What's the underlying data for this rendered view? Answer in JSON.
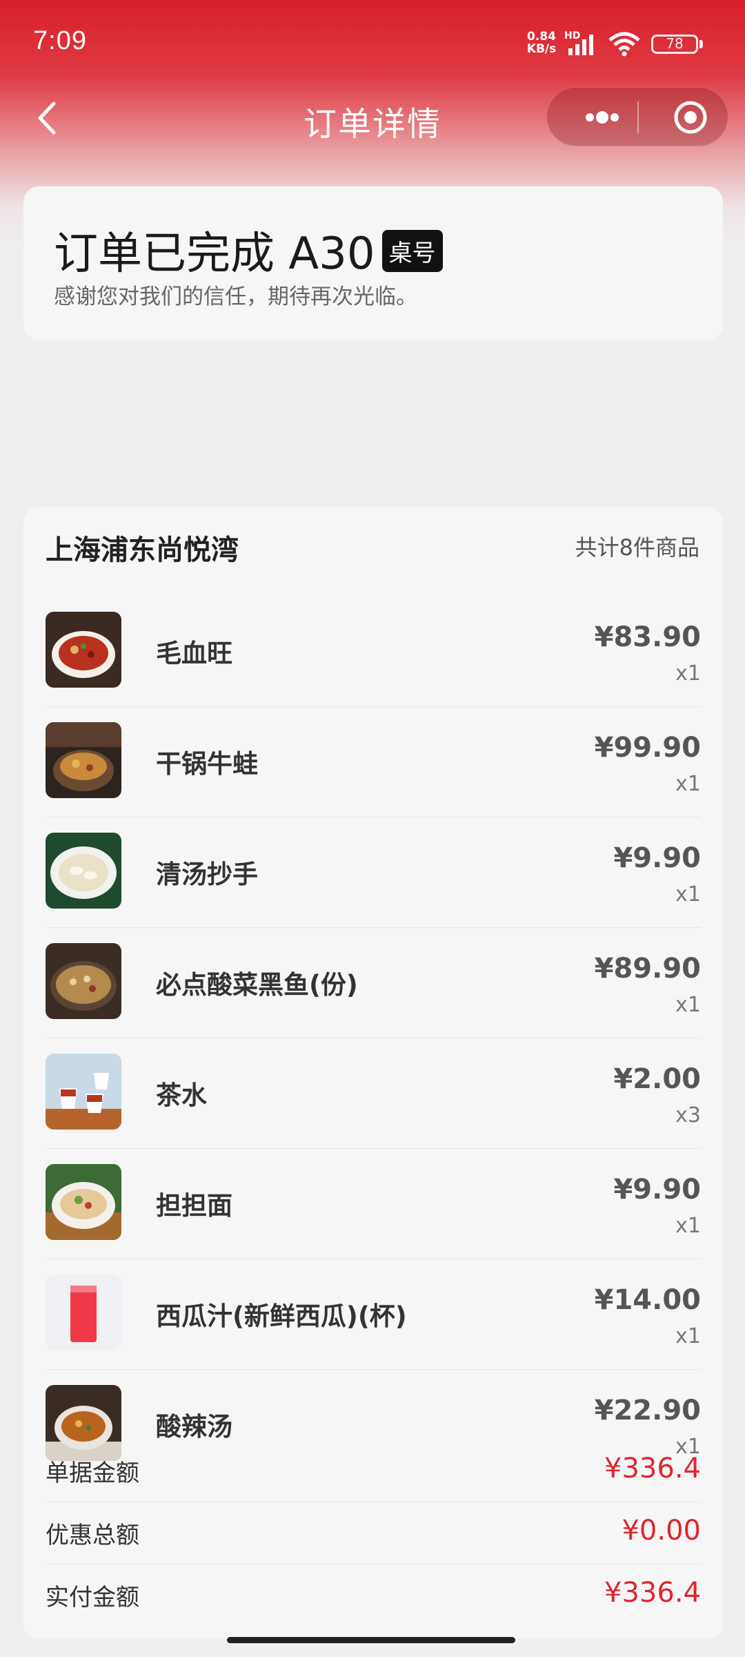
{
  "status_bar": {
    "time": "7:09",
    "net_speed_value": "0.84",
    "net_speed_unit": "KB/s",
    "hd": "HD",
    "battery": "78"
  },
  "nav": {
    "title": "订单详情",
    "icons": [
      "back-icon",
      "more-icon",
      "target-icon"
    ]
  },
  "order_status": {
    "title": "订单已完成 A30",
    "table_badge": "桌号",
    "subtitle": "感谢您对我们的信任，期待再次光临。"
  },
  "order": {
    "store_name": "上海浦东尚悦湾",
    "item_count": "共计8件商品",
    "items": [
      {
        "name": "毛血旺",
        "price": "¥83.90",
        "qty": "x1",
        "thumb": "dish-maoxuewang"
      },
      {
        "name": "干锅牛蛙",
        "price": "¥99.90",
        "qty": "x1",
        "thumb": "dish-ganguo-niuwa"
      },
      {
        "name": "清汤抄手",
        "price": "¥9.90",
        "qty": "x1",
        "thumb": "dish-chaoshou"
      },
      {
        "name": "必点酸菜黑鱼(份)",
        "price": "¥89.90",
        "qty": "x1",
        "thumb": "dish-suancai-yu"
      },
      {
        "name": "茶水",
        "price": "¥2.00",
        "qty": "x3",
        "thumb": "dish-tea"
      },
      {
        "name": "担担面",
        "price": "¥9.90",
        "qty": "x1",
        "thumb": "dish-dandan-mian"
      },
      {
        "name": "西瓜汁(新鲜西瓜)(杯)",
        "price": "¥14.00",
        "qty": "x1",
        "thumb": "dish-watermelon-juice"
      },
      {
        "name": "酸辣汤",
        "price": "¥22.90",
        "qty": "x1",
        "thumb": "dish-suanla-tang"
      }
    ],
    "summary": [
      {
        "label": "单据金额",
        "value": "¥336.4"
      },
      {
        "label": "优惠总额",
        "value": "¥0.00"
      },
      {
        "label": "实付金额",
        "value": "¥336.4"
      }
    ]
  },
  "colors": {
    "brand_red": "#d81f2b",
    "price_red": "#e0252f"
  }
}
